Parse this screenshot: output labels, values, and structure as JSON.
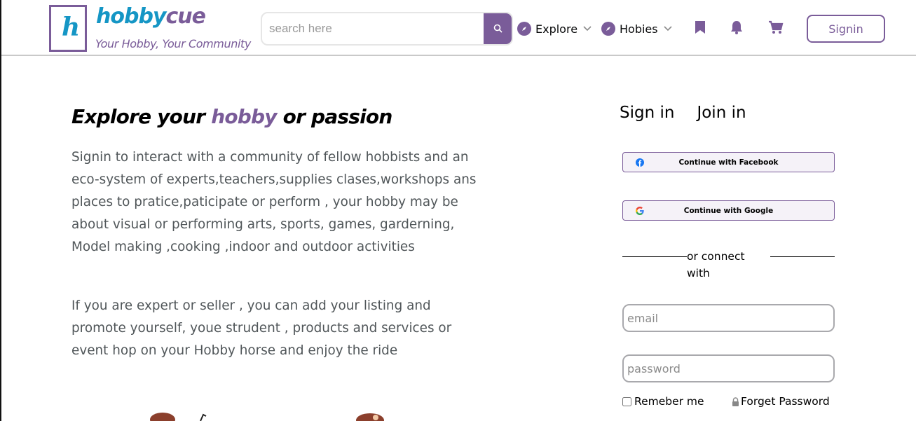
{
  "brand": {
    "logo_letter": "h",
    "name_part1": "hobby",
    "name_part2": "cue",
    "tagline": "Your Hobby, Your Community",
    "primary_color": "#7a5c99",
    "secondary_color": "#1596c5"
  },
  "header": {
    "search_placeholder": "search here",
    "search_icon": "search-icon",
    "nav": [
      {
        "label": "Explore",
        "icon": "compass-icon"
      },
      {
        "label": "Hobies",
        "icon": "compass-icon"
      }
    ],
    "icons": [
      "bookmark-icon",
      "bell-icon",
      "cart-icon"
    ],
    "signin_label": "Signin"
  },
  "hero": {
    "title_before": "Explore your ",
    "title_highlight": "hobby",
    "title_after": " or passion",
    "paragraph1": "Signin to interact with a community of fellow hobbists and an eco-system of experts,teachers,supplies clases,workshops ans places to pratice,paticipate or perform , your hobby may be about visual or performing arts, sports, games, garderning, Model making ,cooking ,indoor and outdoor activities",
    "paragraph2": "If you are expert or seller , you can add your listing and promote yourself, youe strudent , products and services or event hop on your Hobby horse and enjoy the ride"
  },
  "auth": {
    "tabs": [
      "Sign in",
      "Join in"
    ],
    "facebook_label": "Continue with Facebook",
    "google_label": "Continue with Google",
    "divider_text": "or connect with",
    "email_placeholder": "email",
    "password_placeholder": "password",
    "remember_label": "Remeber me",
    "forgot_label": "Forget Password"
  }
}
